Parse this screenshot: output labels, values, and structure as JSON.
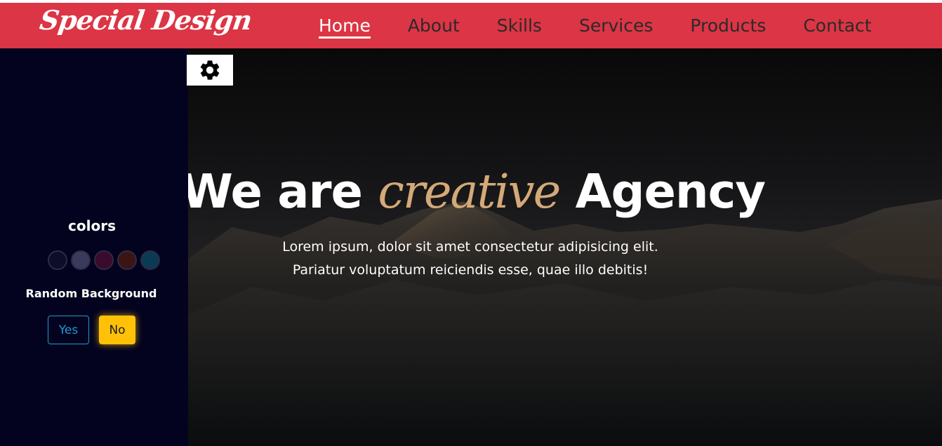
{
  "brand": {
    "logo_text": "Special Design"
  },
  "nav": {
    "items": [
      {
        "label": "Home",
        "active": true
      },
      {
        "label": "About",
        "active": false
      },
      {
        "label": "Skills",
        "active": false
      },
      {
        "label": "Services",
        "active": false
      },
      {
        "label": "Products",
        "active": false
      },
      {
        "label": "Contact",
        "active": false
      }
    ]
  },
  "hero": {
    "title_prefix": "We are",
    "title_accent": "creative",
    "title_suffix": "Agency",
    "text_line1": "Lorem ipsum, dolor sit amet consectetur adipisicing elit.",
    "text_line2": "Pariatur voluptatum reiciendis esse, quae illo debitis!"
  },
  "settings": {
    "toggle_icon": "gear-icon",
    "colors_heading": "colors",
    "swatches": [
      "#0d0d2b",
      "#3a3a5c",
      "#3b0a2c",
      "#3c1414",
      "#0b3a55"
    ],
    "random_bg_label": "Random Background",
    "yes_label": "Yes",
    "no_label": "No"
  },
  "theme": {
    "navbar_bg": "#dc3545",
    "panel_bg": "#03031f",
    "accent": "#d4a978",
    "yes_color": "#1e9bd2",
    "no_bg": "#ffc107"
  }
}
